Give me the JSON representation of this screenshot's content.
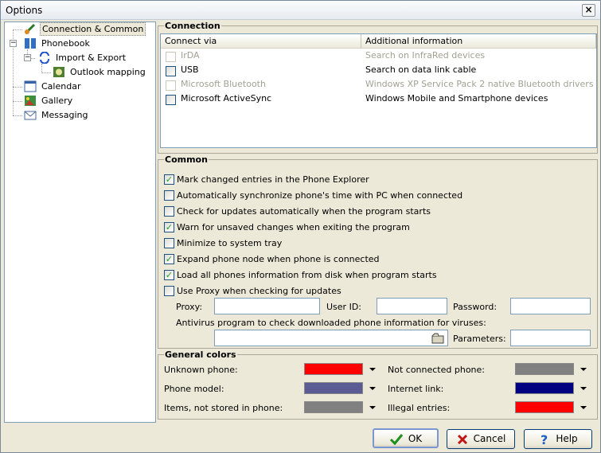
{
  "window": {
    "title": "Options",
    "close_symbol": "×"
  },
  "tree": {
    "items": [
      {
        "label": "Connection & Common",
        "icon": "connection-icon",
        "selected": true
      },
      {
        "label": "Phonebook",
        "icon": "phonebook-icon",
        "expander": "−"
      },
      {
        "label": "Import & Export",
        "icon": "sync-arrows-icon",
        "expander": "−"
      },
      {
        "label": "Outlook mapping",
        "icon": "outlook-icon"
      },
      {
        "label": "Calendar",
        "icon": "calendar-icon"
      },
      {
        "label": "Gallery",
        "icon": "gallery-icon"
      },
      {
        "label": "Messaging",
        "icon": "envelope-icon"
      }
    ]
  },
  "connection": {
    "title": "Connection",
    "columns": [
      "Connect via",
      "Additional information"
    ],
    "rows": [
      {
        "name": "IrDA",
        "info": "Search on InfraRed devices",
        "enabled": false,
        "checked": false
      },
      {
        "name": "USB",
        "info": "Search on data link cable",
        "enabled": true,
        "checked": false
      },
      {
        "name": "Microsoft Bluetooth",
        "info": "Windows XP Service Pack 2 native Bluetooth drivers",
        "enabled": false,
        "checked": false
      },
      {
        "name": "Microsoft ActiveSync",
        "info": "Windows Mobile and Smartphone devices",
        "enabled": true,
        "checked": false
      }
    ]
  },
  "common": {
    "title": "Common",
    "options": [
      {
        "label": "Mark changed entries in the Phone Explorer",
        "checked": true
      },
      {
        "label": "Automatically synchronize phone's time with PC when connected",
        "checked": false
      },
      {
        "label": "Check for updates automatically when the program starts",
        "checked": false
      },
      {
        "label": "Warn for unsaved changes when exiting the program",
        "checked": true
      },
      {
        "label": "Minimize to system tray",
        "checked": false
      },
      {
        "label": "Expand phone node when phone is connected",
        "checked": true
      },
      {
        "label": "Load all phones information from disk when program starts",
        "checked": true
      },
      {
        "label": "Use Proxy when checking for updates",
        "checked": false
      }
    ],
    "check_mark": "✓",
    "proxy_label": "Proxy:",
    "proxy_value": "",
    "userid_label": "User ID:",
    "userid_value": "",
    "password_label": "Password:",
    "password_value": "",
    "antivirus_label": "Antivirus program to check downloaded phone information for viruses:",
    "antivirus_value": "",
    "parameters_label": "Parameters:",
    "parameters_value": ""
  },
  "colors": {
    "title": "General colors",
    "left": [
      {
        "label": "Unknown phone:",
        "color": "#ff0000"
      },
      {
        "label": "Phone model:",
        "color": "#5c5c94"
      },
      {
        "label": "Items, not stored in phone:",
        "color": "#808080"
      }
    ],
    "right": [
      {
        "label": "Not connected phone:",
        "color": "#808080"
      },
      {
        "label": "Internet link:",
        "color": "#000080"
      },
      {
        "label": "Illegal entries:",
        "color": "#ff0000"
      }
    ]
  },
  "buttons": {
    "ok": {
      "label": "OK",
      "icon": "checkmark-icon",
      "color": "#1e8e1e"
    },
    "cancel": {
      "label": "Cancel",
      "icon": "x-icon",
      "color": "#c01818"
    },
    "help": {
      "label": "Help",
      "icon": "question-icon",
      "color": "#1f5fbf"
    }
  }
}
